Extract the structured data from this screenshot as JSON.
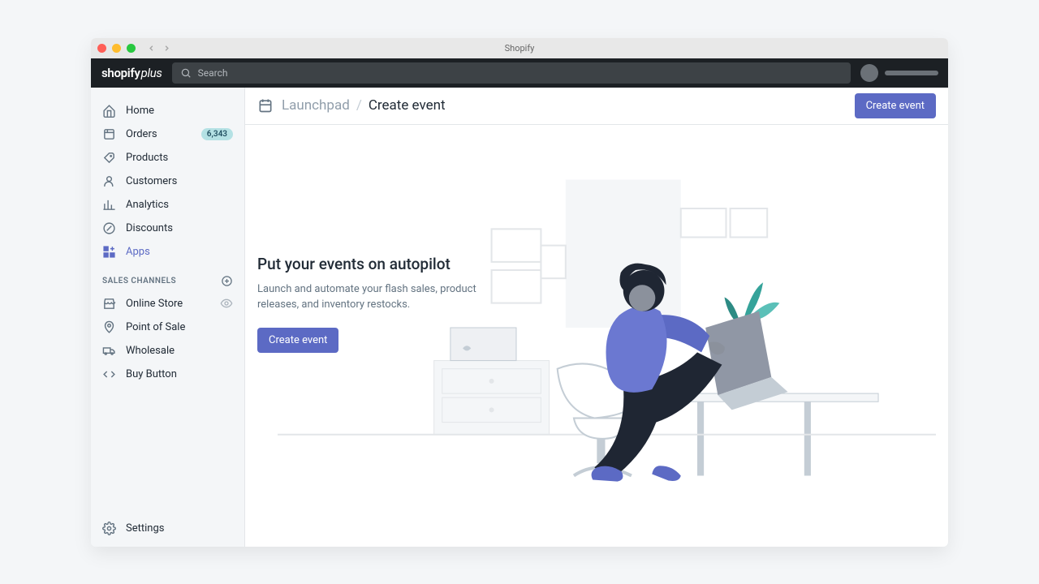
{
  "window": {
    "title": "Shopify"
  },
  "logo": {
    "brand": "shopify",
    "suffix": "plus"
  },
  "search": {
    "placeholder": "Search"
  },
  "sidebar": {
    "items": [
      {
        "label": "Home"
      },
      {
        "label": "Orders",
        "badge": "6,343"
      },
      {
        "label": "Products"
      },
      {
        "label": "Customers"
      },
      {
        "label": "Analytics"
      },
      {
        "label": "Discounts"
      },
      {
        "label": "Apps"
      }
    ],
    "section_header": "SALES CHANNELS",
    "channels": [
      {
        "label": "Online Store"
      },
      {
        "label": "Point of Sale"
      },
      {
        "label": "Wholesale"
      },
      {
        "label": "Buy Button"
      }
    ],
    "settings": "Settings"
  },
  "breadcrumb": {
    "section": "Launchpad",
    "current": "Create event"
  },
  "actions": {
    "create_event": "Create event"
  },
  "hero": {
    "title": "Put your events on autopilot",
    "subtitle": "Launch and automate your flash sales, product releases, and inventory restocks.",
    "cta": "Create event"
  }
}
